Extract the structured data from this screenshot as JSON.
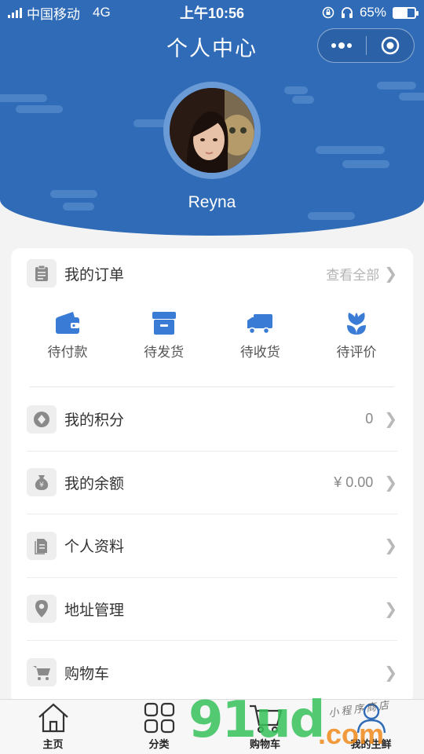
{
  "status_bar": {
    "carrier": "中国移动",
    "network": "4G",
    "time": "上午10:56",
    "battery_percent": "65%",
    "battery_level": 0.65
  },
  "header": {
    "title": "个人中心",
    "username": "Reyna",
    "background_color": "#2f6bb6"
  },
  "orders": {
    "title": "我的订单",
    "view_all": "查看全部",
    "items": [
      {
        "label": "待付款",
        "icon": "wallet-icon"
      },
      {
        "label": "待发货",
        "icon": "package-icon"
      },
      {
        "label": "待收货",
        "icon": "truck-icon"
      },
      {
        "label": "待评价",
        "icon": "flower-icon"
      }
    ],
    "accent_color": "#3a7bd5"
  },
  "menu": [
    {
      "label": "我的积分",
      "value": "0",
      "icon": "points-icon"
    },
    {
      "label": "我的余额",
      "value": "¥  0.00",
      "icon": "money-bag-icon"
    },
    {
      "label": "个人资料",
      "value": "",
      "icon": "profile-doc-icon"
    },
    {
      "label": "地址管理",
      "value": "",
      "icon": "location-pin-icon"
    },
    {
      "label": "购物车",
      "value": "",
      "icon": "cart-icon"
    }
  ],
  "tabbar": [
    {
      "label": "主页",
      "icon": "home-icon"
    },
    {
      "label": "分类",
      "icon": "grid-icon"
    },
    {
      "label": "购物车",
      "icon": "cart-icon"
    },
    {
      "label": "我的生鲜",
      "icon": "user-icon"
    }
  ],
  "watermark": {
    "main": "91ud",
    "suffix": ".com",
    "tagline": "小程序商店"
  }
}
